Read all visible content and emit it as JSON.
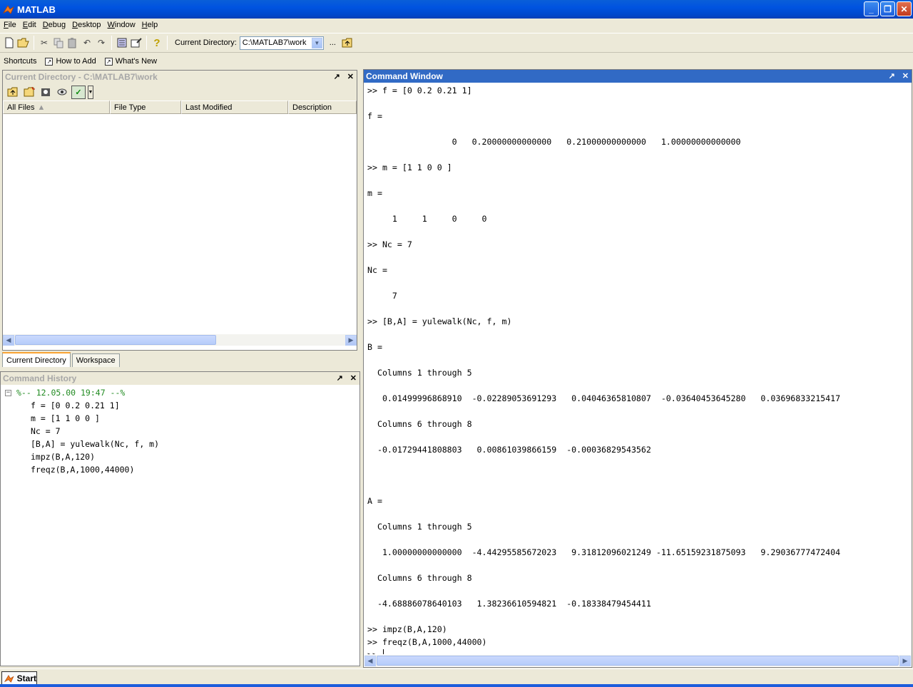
{
  "window": {
    "title": "MATLAB",
    "btn_min": "_",
    "btn_max": "❐",
    "btn_close": "✕"
  },
  "menu": [
    "File",
    "Edit",
    "Debug",
    "Desktop",
    "Window",
    "Help"
  ],
  "toolbar": {
    "current_dir_label": "Current Directory:",
    "current_dir_value": "C:\\MATLAB7\\work",
    "browse_label": "..."
  },
  "shortcuts": {
    "label": "Shortcuts",
    "items": [
      "How to Add",
      "What's New"
    ]
  },
  "current_directory_panel": {
    "title": "Current Directory - C:\\MATLAB7\\work",
    "columns": [
      "All Files",
      "File Type",
      "Last Modified",
      "Description"
    ]
  },
  "tabs": [
    "Current Directory",
    "Workspace"
  ],
  "command_history": {
    "title": "Command History",
    "session": "%-- 12.05.00 19:47 --%",
    "entries": [
      "f = [0 0.2 0.21 1]",
      "m = [1 1 0 0 ]",
      "Nc = 7",
      "[B,A] = yulewalk(Nc, f, m)",
      "impz(B,A,120)",
      "freqz(B,A,1000,44000)"
    ]
  },
  "command_window": {
    "title": "Command Window",
    "lines": [
      ">> f = [0 0.2 0.21 1]",
      "",
      "f =",
      "",
      "                 0   0.20000000000000   0.21000000000000   1.00000000000000",
      "",
      ">> m = [1 1 0 0 ]",
      "",
      "m =",
      "",
      "     1     1     0     0",
      "",
      ">> Nc = 7",
      "",
      "Nc =",
      "",
      "     7",
      "",
      ">> [B,A] = yulewalk(Nc, f, m)",
      "",
      "B =",
      "",
      "  Columns 1 through 5",
      "",
      "   0.01499996868910  -0.02289053691293   0.04046365810807  -0.03640453645280   0.03696833215417",
      "",
      "  Columns 6 through 8",
      "",
      "  -0.01729441808803   0.00861039866159  -0.00036829543562",
      "",
      "",
      "",
      "A =",
      "",
      "  Columns 1 through 5",
      "",
      "   1.00000000000000  -4.44295585672023   9.31812096021249 -11.65159231875093   9.29036777472404",
      "",
      "  Columns 6 through 8",
      "",
      "  -4.68886078640103   1.38236610594821  -0.18338479454411",
      "",
      ">> impz(B,A,120)",
      ">> freqz(B,A,1000,44000)"
    ],
    "prompt": ">> "
  },
  "taskbar": {
    "start_label": "Start"
  }
}
